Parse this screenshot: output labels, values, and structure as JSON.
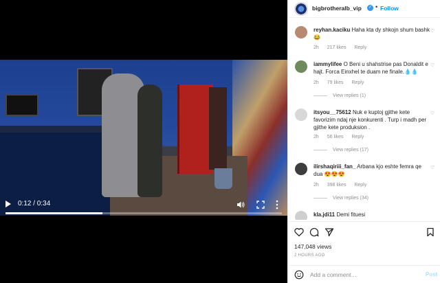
{
  "video": {
    "time": "0:12 / 0:34",
    "progress_fraction": 0.35,
    "controls": {
      "play_icon": "play-icon",
      "volume_icon": "volume-icon",
      "fullscreen_icon": "fullscreen-icon",
      "more_icon": "more-vertical-icon"
    }
  },
  "header": {
    "username": "bigbrotheralb_vip",
    "dot": "•",
    "follow_label": "Follow",
    "accent_color": "#0095f6"
  },
  "comments": [
    {
      "username": "reyhan.kaciku",
      "text": "Haha kta dy shkojn shum bashk 😂",
      "time": "2h",
      "likes": "217 likes",
      "reply": "Reply"
    },
    {
      "username": "iammylifee",
      "text": "O Beni u shahstrise pas Donaldit e hajt. Forca Einxhel te duam ne finale.💧💧",
      "time": "2h",
      "likes": "79 likes",
      "reply": "Reply",
      "view_replies": "View replies (1)"
    },
    {
      "username": "itsyou__75612",
      "text": "Nuk e kuptoj gjithe kete favorizim ndaj nje konkurenti . Turp i madh per gjithe kete produksion .",
      "time": "2h",
      "likes": "56 likes",
      "reply": "Reply",
      "view_replies": "View replies (17)"
    },
    {
      "username": "ilirshaqiriii_fan_",
      "text": "Arbana kjo eshte femra qe dua 😍😍😍",
      "time": "2h",
      "likes": "398 likes",
      "reply": "Reply",
      "view_replies": "View replies (34)"
    },
    {
      "username": "kla.jdi11",
      "text": "Demi fituesi"
    }
  ],
  "actions": {
    "like_icon": "heart-icon",
    "comment_icon": "comment-icon",
    "share_icon": "share-icon",
    "save_icon": "bookmark-icon"
  },
  "stats": {
    "views": "147,048 views",
    "ago": "2 HOURS AGO"
  },
  "add_comment": {
    "placeholder": "Add a comment…",
    "post_label": "Post",
    "emoji_icon": "emoji-icon"
  }
}
